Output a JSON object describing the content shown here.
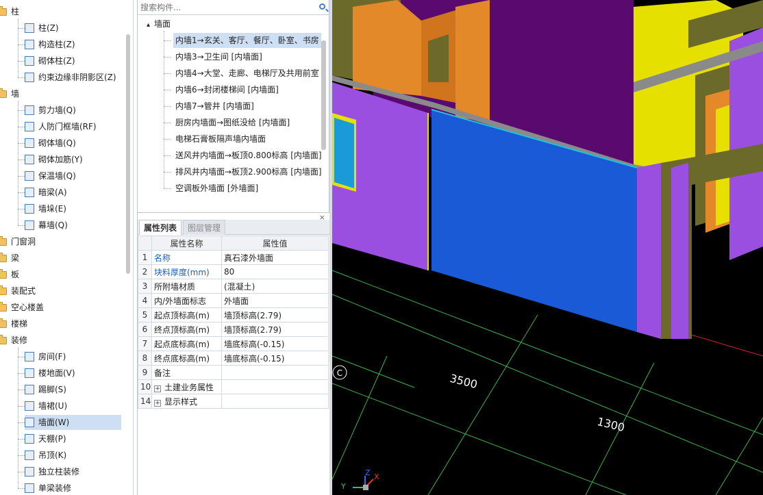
{
  "left_tree": {
    "categories": [
      {
        "label": "柱",
        "items": [
          "柱(Z)",
          "构造柱(Z)",
          "砌体柱(Z)",
          "约束边缘非阴影区(Z)"
        ]
      },
      {
        "label": "墙",
        "items": [
          "剪力墙(Q)",
          "人防门框墙(RF)",
          "砌体墙(Q)",
          "砌体加筋(Y)",
          "保温墙(Q)",
          "暗梁(A)",
          "墙垛(E)",
          "幕墙(Q)"
        ]
      },
      {
        "label": "门窗洞",
        "items": []
      },
      {
        "label": "梁",
        "items": []
      },
      {
        "label": "板",
        "items": []
      },
      {
        "label": "装配式",
        "items": []
      },
      {
        "label": "空心楼盖",
        "items": []
      },
      {
        "label": "楼梯",
        "items": []
      },
      {
        "label": "装修",
        "items": [
          "房间(F)",
          "楼地面(V)",
          "踢脚(S)",
          "墙裙(U)",
          "墙面(W)",
          "天棚(P)",
          "吊顶(K)",
          "独立柱装修",
          "单梁装修"
        ]
      }
    ],
    "selected": "墙面(W)"
  },
  "search": {
    "placeholder": "搜索构件..."
  },
  "component_tree": {
    "root": "墙面",
    "items": [
      "内墙1→玄关、客厅、餐厅、卧室、书房",
      "内墙3→卫生间 [内墙面]",
      "内墙4→大堂、走廊、电梯厅及共用前室",
      "内墙6→封闭楼梯间 [内墙面]",
      "内墙7→管井 [内墙面]",
      "厨房内墙面→图纸没给 [内墙面]",
      "电梯石膏板隔声墙内墙面",
      "送风井内墙面→板顶0.800标高 [内墙面]",
      "排风井内墙面→板顶2.900标高 [内墙面]",
      "空调板外墙面 [外墙面]"
    ],
    "selected_index": 0
  },
  "properties": {
    "tabs": [
      "属性列表",
      "图层管理"
    ],
    "close": "×",
    "headers": {
      "name": "属性名称",
      "value": "属性值"
    },
    "rows": [
      {
        "num": "1",
        "name": "名称",
        "value": "真石漆外墙面",
        "blue": true
      },
      {
        "num": "2",
        "name": "块料厚度(mm)",
        "value": "80",
        "blue": true
      },
      {
        "num": "3",
        "name": "所附墙材质",
        "value": "(混凝土)",
        "blue": false
      },
      {
        "num": "4",
        "name": "内/外墙面标志",
        "value": "外墙面",
        "blue": false
      },
      {
        "num": "5",
        "name": "起点顶标高(m)",
        "value": "墙顶标高(2.79)",
        "blue": false
      },
      {
        "num": "6",
        "name": "终点顶标高(m)",
        "value": "墙顶标高(2.79)",
        "blue": false
      },
      {
        "num": "7",
        "name": "起点底标高(m)",
        "value": "墙底标高(-0.15)",
        "blue": false
      },
      {
        "num": "8",
        "name": "终点底标高(m)",
        "value": "墙底标高(-0.15)",
        "blue": false
      },
      {
        "num": "9",
        "name": "备注",
        "value": "",
        "blue": false
      },
      {
        "num": "10",
        "name": "土建业务属性",
        "value": "",
        "blue": false,
        "expandable": true
      },
      {
        "num": "14",
        "name": "显示样式",
        "value": "",
        "blue": false,
        "expandable": true
      }
    ]
  },
  "viewport": {
    "axis_label": "C",
    "dim1": "3500",
    "dim2": "1300",
    "gizmo": {
      "y": "Y",
      "z": "Z",
      "x": "X"
    },
    "colors": {
      "background": "#000000",
      "purple": "#9b4fe0",
      "blue": "#1a5ad6",
      "orange": "#e3892a",
      "yellow": "#e6e000",
      "deep_purple": "#5a0a6e",
      "olive": "#6b6a2a",
      "grid": "#3db54a"
    }
  }
}
